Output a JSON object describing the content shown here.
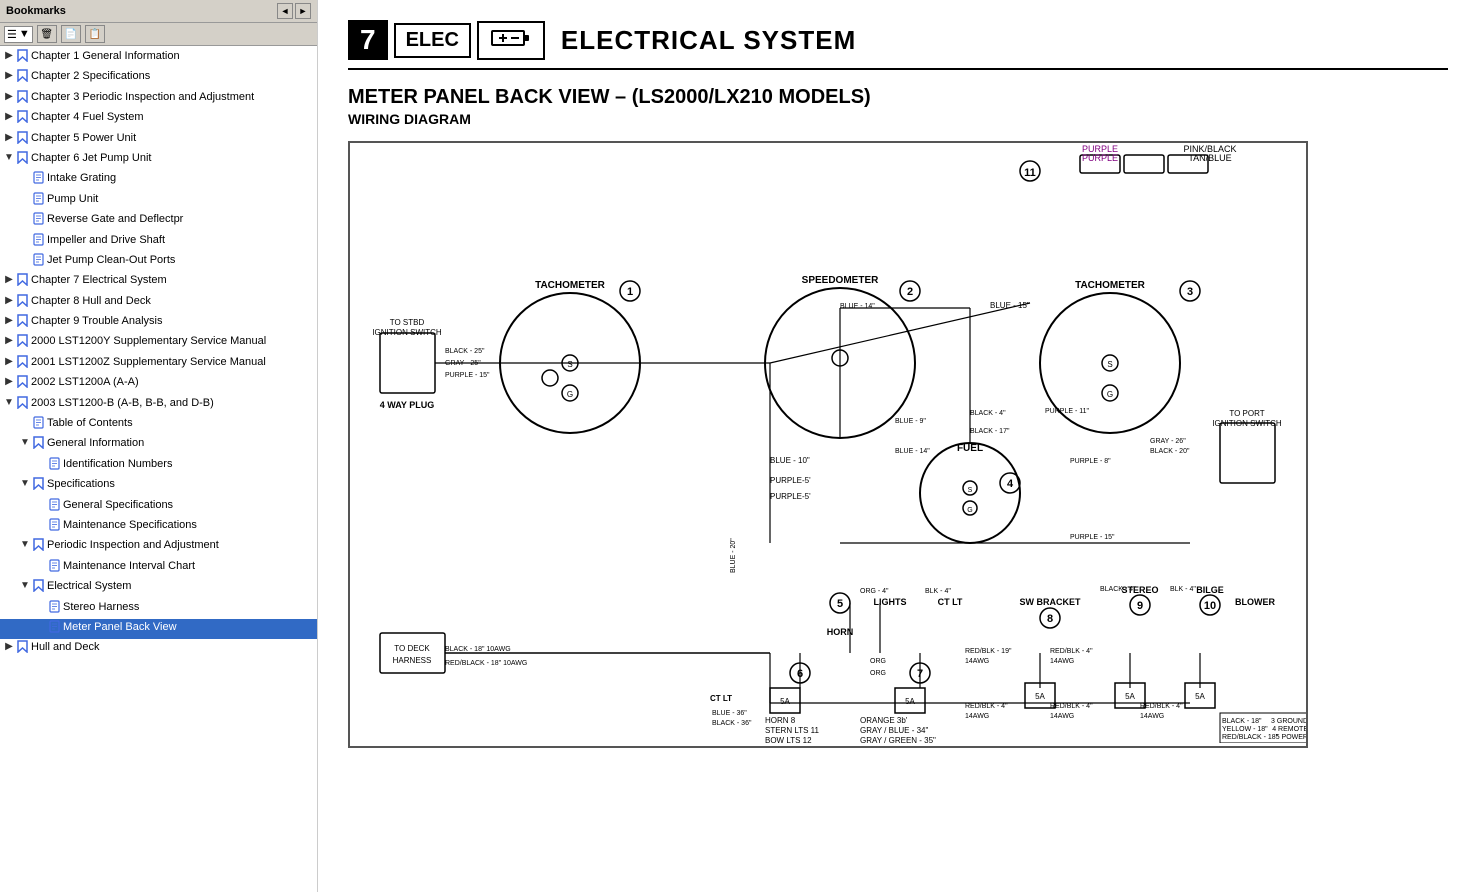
{
  "sidebar": {
    "title": "Bookmarks",
    "nav_buttons": [
      "◄",
      "►"
    ],
    "toolbar_buttons": [
      "new",
      "delete",
      "copy",
      "paste"
    ],
    "dropdown_label": "▼",
    "tree": [
      {
        "id": "ch1",
        "level": 0,
        "label": "Chapter 1 General Information",
        "expanded": false,
        "has_children": true,
        "icon": "bookmark"
      },
      {
        "id": "ch2",
        "level": 0,
        "label": "Chapter 2 Specifications",
        "expanded": false,
        "has_children": true,
        "icon": "bookmark"
      },
      {
        "id": "ch3",
        "level": 0,
        "label": "Chapter 3 Periodic Inspection and Adjustment",
        "expanded": false,
        "has_children": true,
        "icon": "bookmark"
      },
      {
        "id": "ch4",
        "level": 0,
        "label": "Chapter 4 Fuel System",
        "expanded": false,
        "has_children": true,
        "icon": "bookmark"
      },
      {
        "id": "ch5",
        "level": 0,
        "label": "Chapter 5 Power Unit",
        "expanded": false,
        "has_children": true,
        "icon": "bookmark"
      },
      {
        "id": "ch6",
        "level": 0,
        "label": "Chapter 6 Jet Pump Unit",
        "expanded": true,
        "has_children": true,
        "icon": "bookmark"
      },
      {
        "id": "ch6-1",
        "level": 1,
        "label": "Intake Grating",
        "expanded": false,
        "has_children": false,
        "icon": "page"
      },
      {
        "id": "ch6-2",
        "level": 1,
        "label": "Pump Unit",
        "expanded": false,
        "has_children": false,
        "icon": "page"
      },
      {
        "id": "ch6-3",
        "level": 1,
        "label": "Reverse Gate and Deflectpr",
        "expanded": false,
        "has_children": false,
        "icon": "page"
      },
      {
        "id": "ch6-4",
        "level": 1,
        "label": "Impeller and Drive Shaft",
        "expanded": false,
        "has_children": false,
        "icon": "page"
      },
      {
        "id": "ch6-5",
        "level": 1,
        "label": "Jet Pump Clean-Out Ports",
        "expanded": false,
        "has_children": false,
        "icon": "page"
      },
      {
        "id": "ch7",
        "level": 0,
        "label": "Chapter 7 Electrical System",
        "expanded": false,
        "has_children": true,
        "icon": "bookmark"
      },
      {
        "id": "ch8",
        "level": 0,
        "label": "Chapter 8 Hull and Deck",
        "expanded": false,
        "has_children": true,
        "icon": "bookmark"
      },
      {
        "id": "ch9",
        "level": 0,
        "label": "Chapter 9 Trouble Analysis",
        "expanded": false,
        "has_children": true,
        "icon": "bookmark"
      },
      {
        "id": "ch10",
        "level": 0,
        "label": "2000 LST1200Y Supplementary Service Manual",
        "expanded": false,
        "has_children": true,
        "icon": "bookmark"
      },
      {
        "id": "ch11",
        "level": 0,
        "label": "2001 LST1200Z Supplementary Service Manual",
        "expanded": false,
        "has_children": true,
        "icon": "bookmark"
      },
      {
        "id": "ch12",
        "level": 0,
        "label": "2002 LST1200A (A-A)",
        "expanded": false,
        "has_children": true,
        "icon": "bookmark"
      },
      {
        "id": "ch13",
        "level": 0,
        "label": "2003 LST1200-B (A-B, B-B, and D-B)",
        "expanded": true,
        "has_children": true,
        "icon": "bookmark"
      },
      {
        "id": "ch13-1",
        "level": 1,
        "label": "Table of Contents",
        "expanded": false,
        "has_children": false,
        "icon": "page"
      },
      {
        "id": "ch13-2",
        "level": 1,
        "label": "General Information",
        "expanded": true,
        "has_children": true,
        "icon": "bookmark"
      },
      {
        "id": "ch13-2-1",
        "level": 2,
        "label": "Identification Numbers",
        "expanded": false,
        "has_children": false,
        "icon": "page"
      },
      {
        "id": "ch13-3",
        "level": 1,
        "label": "Specifications",
        "expanded": true,
        "has_children": true,
        "icon": "bookmark"
      },
      {
        "id": "ch13-3-1",
        "level": 2,
        "label": "General Specifications",
        "expanded": false,
        "has_children": false,
        "icon": "page"
      },
      {
        "id": "ch13-3-2",
        "level": 2,
        "label": "Maintenance Specifications",
        "expanded": false,
        "has_children": false,
        "icon": "page"
      },
      {
        "id": "ch13-4",
        "level": 1,
        "label": "Periodic Inspection and Adjustment",
        "expanded": true,
        "has_children": true,
        "icon": "bookmark"
      },
      {
        "id": "ch13-4-1",
        "level": 2,
        "label": "Maintenance Interval Chart",
        "expanded": false,
        "has_children": false,
        "icon": "page"
      },
      {
        "id": "ch13-5",
        "level": 1,
        "label": "Electrical System",
        "expanded": true,
        "has_children": true,
        "icon": "bookmark"
      },
      {
        "id": "ch13-5-1",
        "level": 2,
        "label": "Stereo Harness",
        "expanded": false,
        "has_children": false,
        "icon": "page"
      },
      {
        "id": "ch13-5-2",
        "level": 2,
        "label": "Meter Panel Back View",
        "expanded": false,
        "has_children": false,
        "icon": "page",
        "selected": true
      },
      {
        "id": "ch14",
        "level": 0,
        "label": "Hull and Deck",
        "expanded": false,
        "has_children": true,
        "icon": "bookmark"
      }
    ]
  },
  "main": {
    "chapter_number": "7",
    "chapter_code": "ELEC",
    "chapter_full_title": "ELECTRICAL SYSTEM",
    "section_title": "METER PANEL BACK VIEW – (LS2000/LX210 MODELS)",
    "section_subtitle": "WIRING DIAGRAM"
  }
}
